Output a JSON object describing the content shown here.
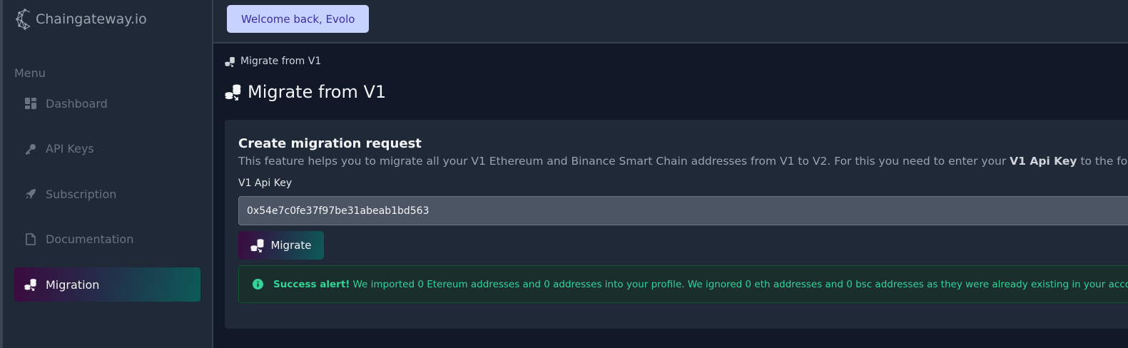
{
  "app": {
    "name": "Chaingateway.io"
  },
  "sidebar": {
    "menu_heading": "Menu",
    "items": [
      {
        "label": "Dashboard",
        "icon": "dashboard-icon",
        "active": false
      },
      {
        "label": "API Keys",
        "icon": "key-icon",
        "active": false
      },
      {
        "label": "Subscription",
        "icon": "rocket-icon",
        "active": false
      },
      {
        "label": "Documentation",
        "icon": "document-icon",
        "active": false
      },
      {
        "label": "Migration",
        "icon": "coins-migrate-icon",
        "active": true
      }
    ]
  },
  "header": {
    "welcome": "Welcome back, Evolo"
  },
  "breadcrumb": {
    "label": "Migrate from V1",
    "icon": "coins-migrate-icon"
  },
  "page": {
    "title": "Migrate from V1"
  },
  "card": {
    "title": "Create migration request",
    "description_before": "This feature helps you to migrate all your V1 Ethereum and Binance Smart Chain addresses from V1 to V2. For this you need to enter your ",
    "description_bold": "V1 Api Key",
    "description_after": " to the form.",
    "field_label": "V1 Api Key",
    "field_value": "0x54e7c0fe37f97be31abeab1bd563",
    "button_label": "Migrate"
  },
  "alert": {
    "type": "success",
    "icon": "info-circle-icon",
    "strong": "Success alert!",
    "message": "We imported 0 Etereum addresses and 0 addresses into your profile. We ignored 0 eth addresses and 0 bsc addresses as they were already existing in your account"
  },
  "colors": {
    "background": "#111827",
    "panel": "#1f2937",
    "accent_gradient_start": "#3b0a3f",
    "accent_gradient_end": "#0d5a58",
    "welcome_bg": "#c7d2fe",
    "welcome_text": "#3730a3",
    "success_text": "#34d399"
  }
}
